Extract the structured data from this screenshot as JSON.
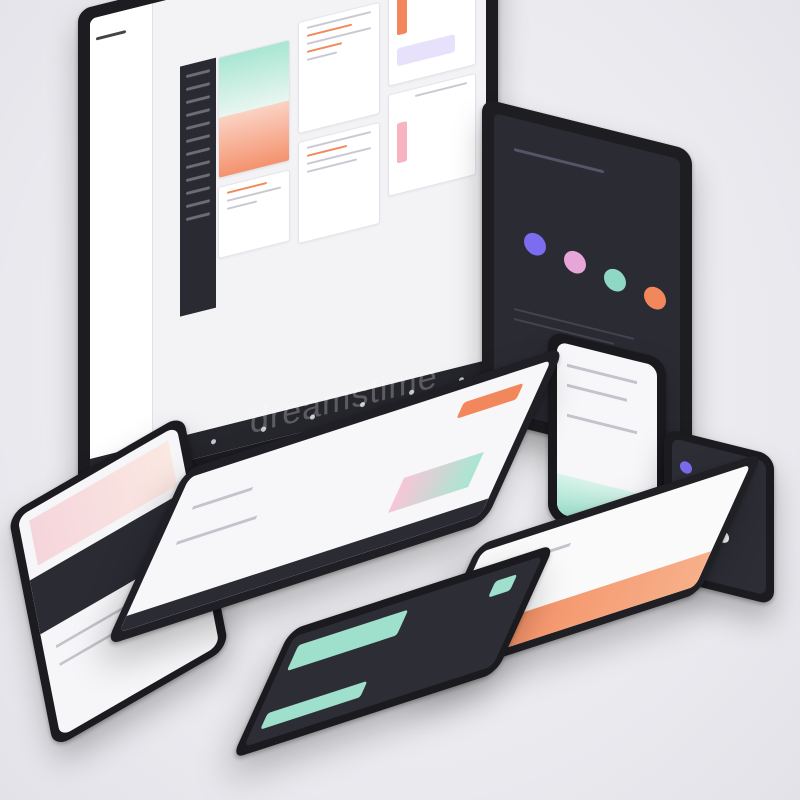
{
  "monitor": {
    "sidebar_labels": [
      "",
      "",
      "",
      "",
      "",
      "",
      "",
      ""
    ],
    "card_titles": [
      "",
      "",
      "",
      "",
      ""
    ]
  },
  "watermark": "dreamstime",
  "colors": {
    "accent_orange": "#f3875c",
    "accent_mint": "#9fe0cc",
    "accent_lavender": "#c9b8f0",
    "dark_panel": "#2b2b34",
    "purple": "#7b6cf0",
    "pink": "#e7a6d8",
    "teal": "#8fd8c6"
  },
  "icons": [
    "monitor-dock-icons",
    "circle-avatar-icons"
  ]
}
